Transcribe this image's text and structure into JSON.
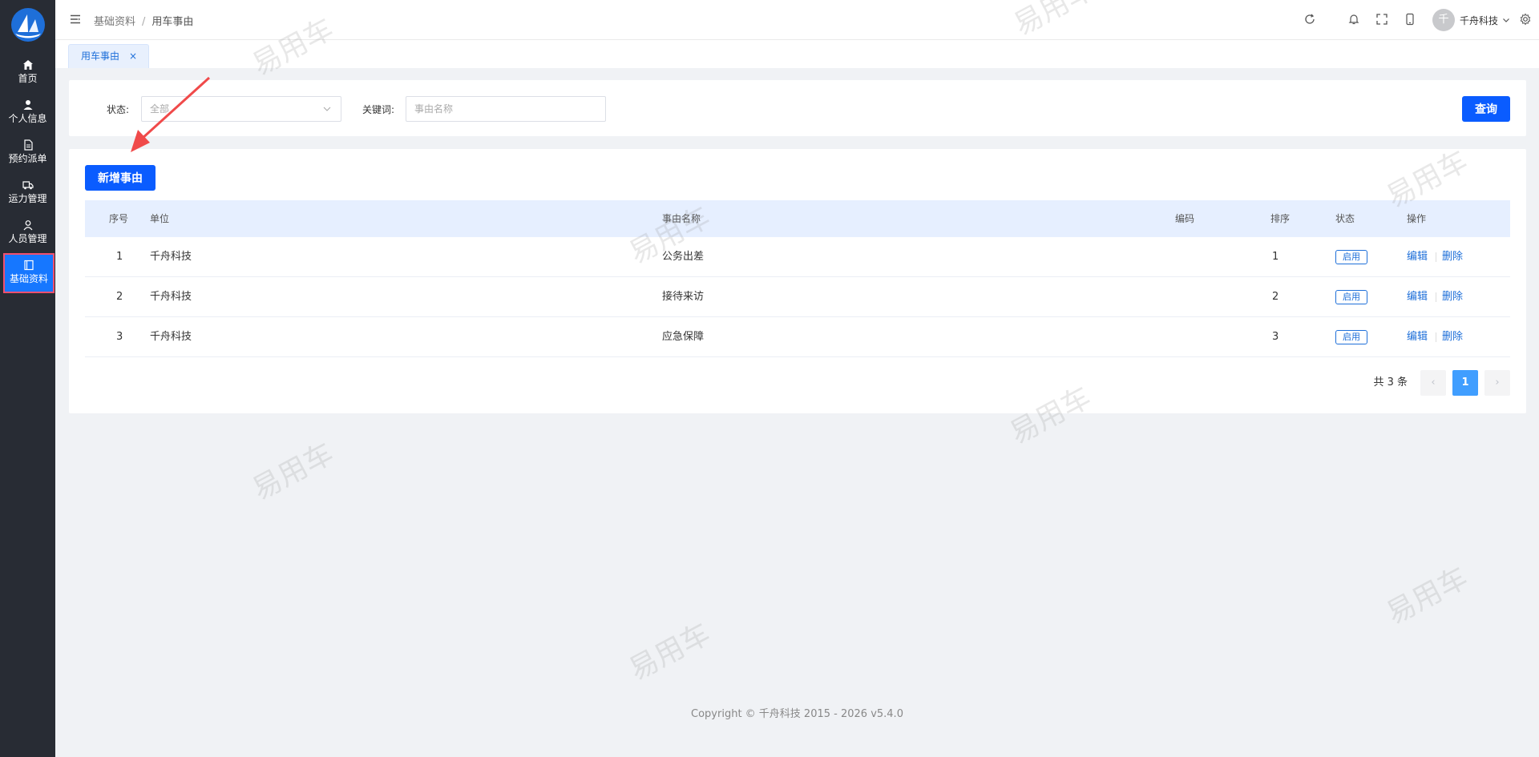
{
  "sidebar": {
    "items": [
      {
        "label": "首页",
        "icon": "home-icon"
      },
      {
        "label": "个人信息",
        "icon": "user-icon"
      },
      {
        "label": "预约派单",
        "icon": "document-icon"
      },
      {
        "label": "运力管理",
        "icon": "truck-icon"
      },
      {
        "label": "人员管理",
        "icon": "person-icon"
      },
      {
        "label": "基础资料",
        "icon": "book-icon",
        "active": true
      }
    ]
  },
  "header": {
    "breadcrumb": [
      "基础资料",
      "用车事由"
    ],
    "breadcrumb_sep": "/",
    "user": {
      "avatar_text": "千",
      "name": "千舟科技"
    }
  },
  "tabs": [
    {
      "label": "用车事由",
      "close": "×"
    }
  ],
  "search": {
    "status_label": "状态:",
    "status_value": "全部",
    "keyword_label": "关键词:",
    "keyword_placeholder": "事由名称",
    "query_button": "查询"
  },
  "table": {
    "add_button": "新增事由",
    "columns": [
      "序号",
      "单位",
      "事由名称",
      "编码",
      "排序",
      "状态",
      "操作"
    ],
    "rows": [
      {
        "index": "1",
        "unit": "千舟科技",
        "name": "公务出差",
        "code": "",
        "sort": "1",
        "status": "启用",
        "edit": "编辑",
        "delete": "删除"
      },
      {
        "index": "2",
        "unit": "千舟科技",
        "name": "接待来访",
        "code": "",
        "sort": "2",
        "status": "启用",
        "edit": "编辑",
        "delete": "删除"
      },
      {
        "index": "3",
        "unit": "千舟科技",
        "name": "应急保障",
        "code": "",
        "sort": "3",
        "status": "启用",
        "edit": "编辑",
        "delete": "删除"
      }
    ]
  },
  "pagination": {
    "total_text": "共 3 条",
    "prev": "‹",
    "current_page": "1",
    "next": "›"
  },
  "footer": {
    "copyright": "Copyright © 千舟科技 2015 - 2026 v5.4.0"
  },
  "watermark": "易用车",
  "colors": {
    "primary": "#0a5cff",
    "sidebar_bg": "#282c34",
    "active_border": "#f0506e",
    "link": "#1e6fd9"
  }
}
